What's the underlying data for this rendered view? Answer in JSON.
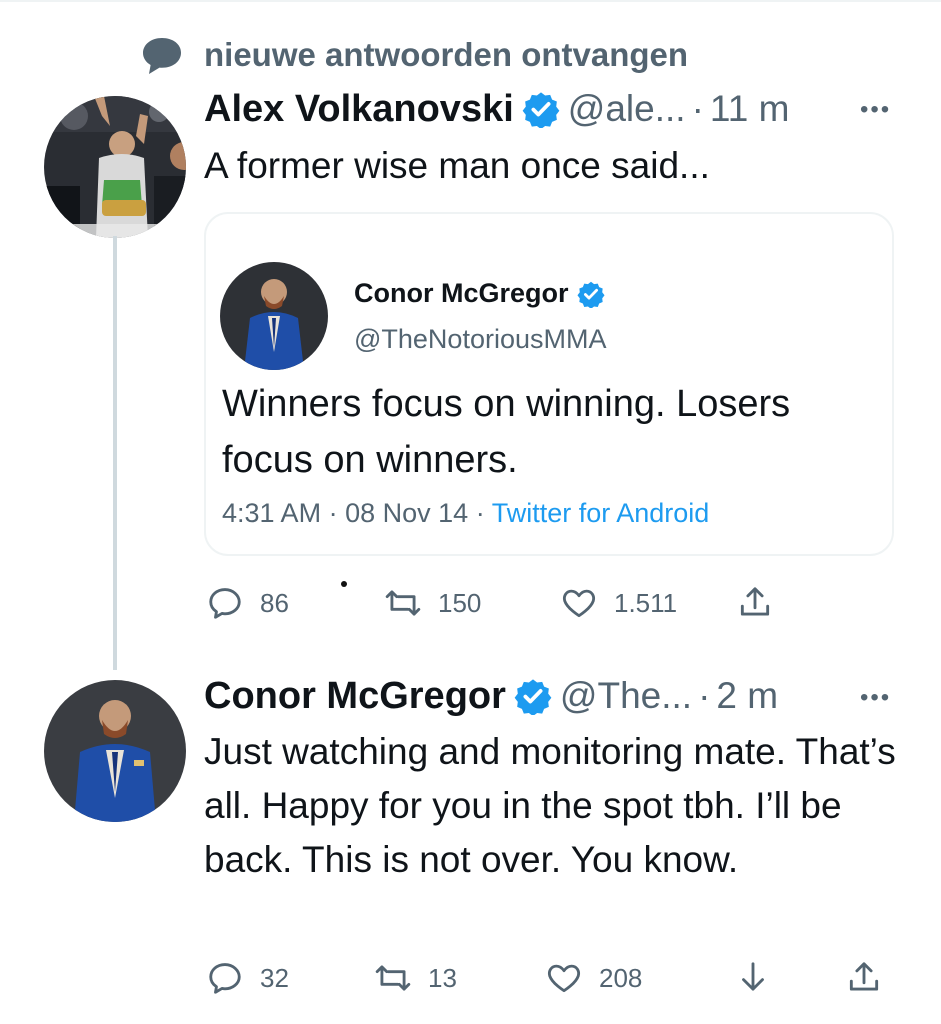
{
  "notice": {
    "text": "nieuwe antwoorden ontvangen",
    "icon": "speech-bubble-icon"
  },
  "colors": {
    "verified": "#1d9bf0",
    "secondary": "#536471",
    "link": "#1d9bf0",
    "thread_line": "#cfd9de"
  },
  "tweet1": {
    "name": "Alex Volkanovski",
    "handle": "@ale...",
    "time": "11 m",
    "text": "A former wise man once said...",
    "quote": {
      "name": "Conor McGregor",
      "handle": "@TheNotoriousMMA",
      "text": "Winners focus on winning. Losers focus on winners.",
      "time": "4:31 AM",
      "date": "08 Nov 14",
      "source": "Twitter for Android"
    },
    "replies": "86",
    "retweets": "150",
    "likes": "1.511"
  },
  "tweet2": {
    "name": "Conor McGregor",
    "handle": "@The...",
    "time": "2 m",
    "text": "Just watching and monitoring mate. That’s all. Happy for you in the spot tbh. I’ll be back. This is not over. You know.",
    "replies": "32",
    "retweets": "13",
    "likes": "208"
  },
  "separator": "·",
  "more_label": "•••"
}
